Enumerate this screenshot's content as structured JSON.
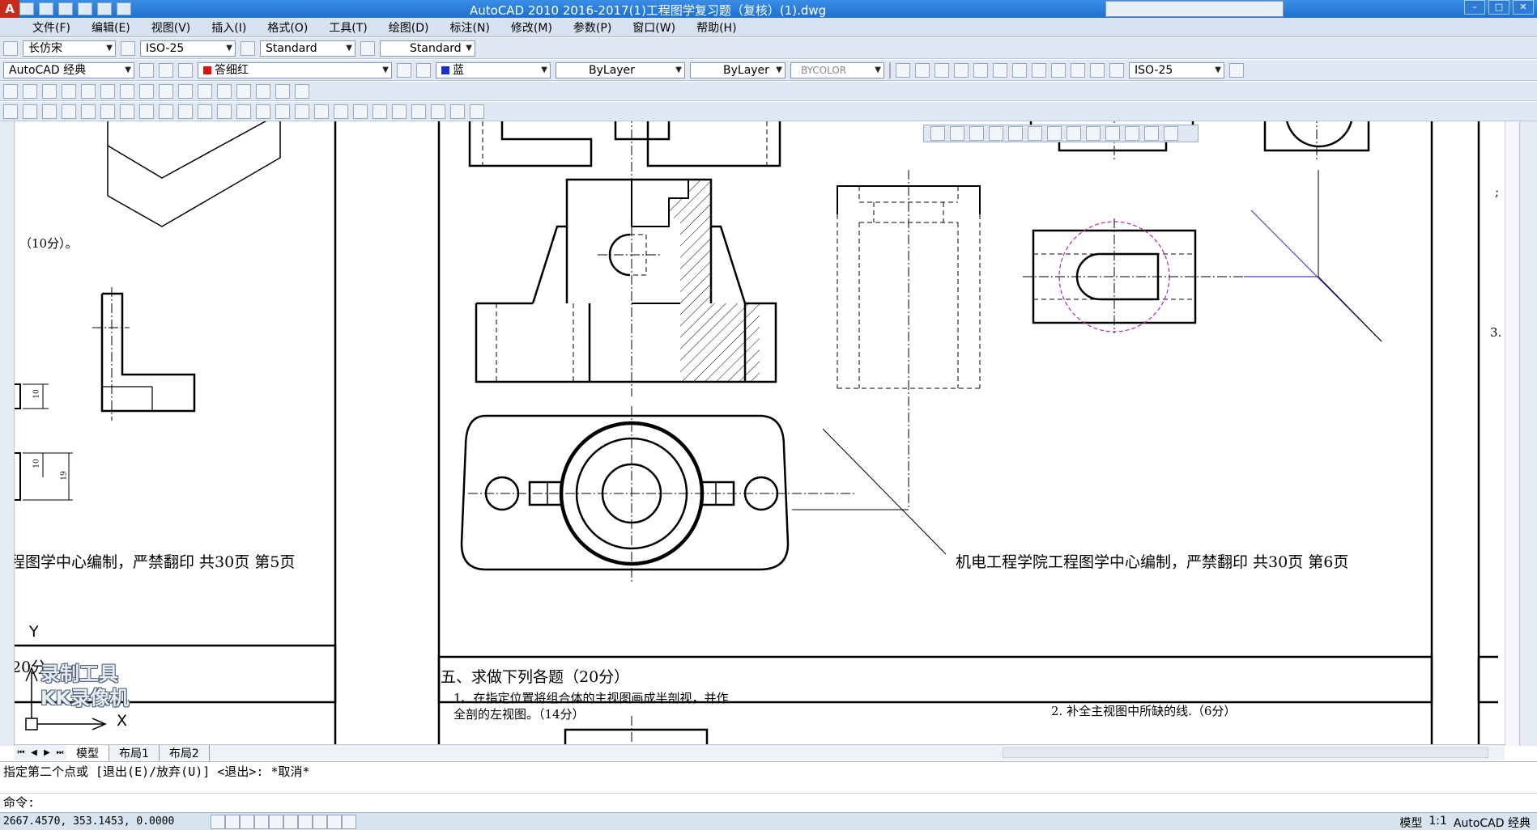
{
  "app": {
    "logo_letter": "A",
    "title": "AutoCAD 2010    2016-2017(1)工程图学复习题（复核）(1).dwg"
  },
  "menu": [
    "文件(F)",
    "编辑(E)",
    "视图(V)",
    "插入(I)",
    "格式(O)",
    "工具(T)",
    "绘图(D)",
    "标注(N)",
    "修改(M)",
    "参数(P)",
    "窗口(W)",
    "帮助(H)"
  ],
  "toolbar1": {
    "font": "长仿宋",
    "dim_style": "ISO-25",
    "text_style": "Standard",
    "table_style": "Standard"
  },
  "toolbar2": {
    "workspace": "AutoCAD 经典",
    "layer": "答细红",
    "layer_color": "#e01010",
    "color": "蓝",
    "color_swatch": "#1b2fd0",
    "linetype": "ByLayer",
    "lineweight": "ByLayer",
    "plotstyle": "BYCOLOR",
    "dim_style2": "ISO-25"
  },
  "drawing": {
    "page5_footer": "程图学中心编制，严禁翻印  共30页  第5页",
    "page6_footer": "机电工程学院工程图学中心编制，严禁翻印  共30页  第6页",
    "score_10": "（10分）。",
    "section5_title": "五、求做下列各题（20分）",
    "q1_line1": "1、在指定位置将组合体的主视图画成半剖视，并作",
    "q1_line2": "全剖的左视图。（14分）",
    "q2": "2. 补全主视图中所缺的线.（6分）",
    "left_score": "20分",
    "y_axis": "Y",
    "x_axis": "X",
    "right_num": "3.",
    "right_colon": ";",
    "dim_10a": "10",
    "dim_10b": "10",
    "dim_19": "19"
  },
  "watermark": {
    "line1": "录制工具",
    "line2": "KK录像机"
  },
  "tabs": [
    "模型",
    "布局1",
    "布局2"
  ],
  "command": {
    "history": "指定第二个点或 [退出(E)/放弃(U)] <退出>:  *取消*",
    "prompt": "命令:"
  },
  "status": {
    "coords": "2667.4570, 353.1453, 0.0000",
    "model": "模型",
    "scale": "1:1",
    "workspace": "AutoCAD 经典"
  }
}
